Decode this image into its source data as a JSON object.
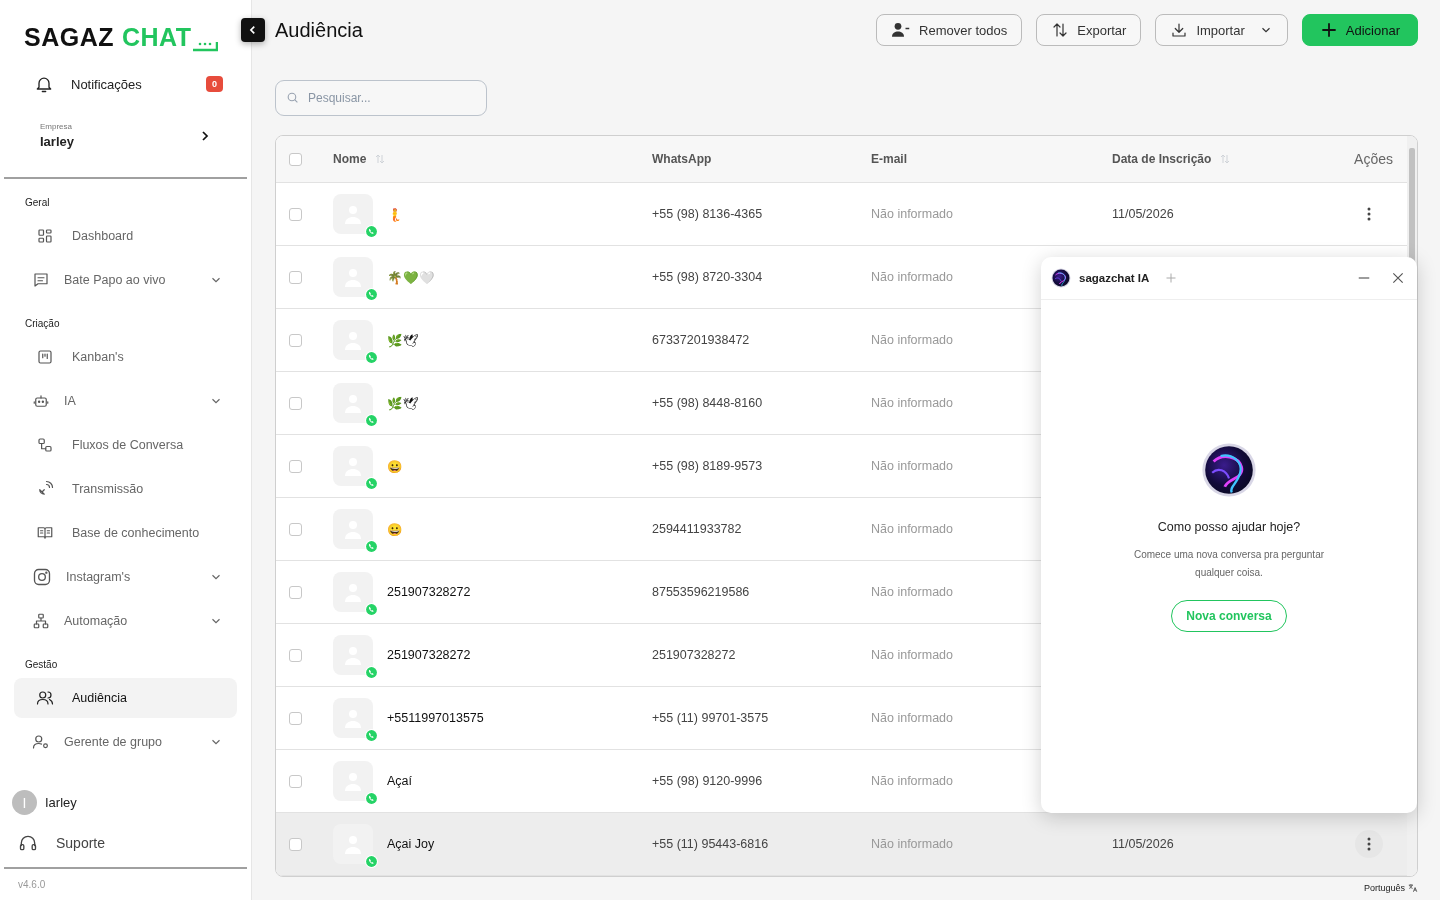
{
  "sidebar": {
    "logo": {
      "dark": "SAGAZ",
      "accent": "CHAT"
    },
    "notifications": {
      "label": "Notificações",
      "count": "0"
    },
    "company": {
      "caption": "Empresa",
      "name": "Iarley"
    },
    "sections": [
      {
        "title": "Geral",
        "items": [
          {
            "label": "Dashboard",
            "expandable": false,
            "selected": false
          },
          {
            "label": "Bate Papo ao vivo",
            "expandable": true,
            "selected": false
          }
        ]
      },
      {
        "title": "Criação",
        "items": [
          {
            "label": "Kanban's",
            "expandable": false,
            "selected": false
          },
          {
            "label": "IA",
            "expandable": true,
            "selected": false
          },
          {
            "label": "Fluxos de Conversa",
            "expandable": false,
            "selected": false
          },
          {
            "label": "Transmissão",
            "expandable": false,
            "selected": false
          },
          {
            "label": "Base de conhecimento",
            "expandable": false,
            "selected": false
          },
          {
            "label": "Instagram's",
            "expandable": true,
            "selected": false
          },
          {
            "label": "Automação",
            "expandable": true,
            "selected": false
          }
        ]
      },
      {
        "title": "Gestão",
        "items": [
          {
            "label": "Audiência",
            "expandable": false,
            "selected": true
          },
          {
            "label": "Gerente de grupo",
            "expandable": true,
            "selected": false
          }
        ]
      }
    ],
    "user": {
      "initial": "I",
      "name": "Iarley"
    },
    "support": "Suporte",
    "version": "v4.6.0"
  },
  "page": {
    "title": "Audiência",
    "actions": [
      {
        "label": "Remover todos",
        "kind": "outline"
      },
      {
        "label": "Exportar",
        "kind": "outline"
      },
      {
        "label": "Importar",
        "kind": "dropdown"
      },
      {
        "label": "Adicionar",
        "kind": "primary"
      }
    ],
    "search": {
      "placeholder": "Pesquisar..."
    }
  },
  "table": {
    "all_checked": false,
    "columns": [
      {
        "label": "Nome",
        "sortable": true
      },
      {
        "label": "WhatsApp",
        "sortable": false
      },
      {
        "label": "E-mail",
        "sortable": false
      },
      {
        "label": "Data de Inscrição",
        "sortable": true
      },
      {
        "label": "Ações",
        "sortable": false
      }
    ],
    "rows": [
      {
        "name": "🧜",
        "whatsapp": "+55 (98) 8136-4365",
        "email": "Não informado",
        "date": "11/05/2026",
        "checked": false,
        "highlighted": false
      },
      {
        "name": "🌴💚🤍",
        "whatsapp": "+55 (98) 8720-3304",
        "email": "Não informado",
        "checked": false,
        "highlighted": false
      },
      {
        "name": "🌿🕊",
        "whatsapp": "67337201938472",
        "email": "Não informado",
        "checked": false,
        "highlighted": false
      },
      {
        "name": "🌿🕊",
        "whatsapp": "+55 (98) 8448-8160",
        "email": "Não informado",
        "checked": false,
        "highlighted": false
      },
      {
        "name": "😀",
        "whatsapp": "+55 (98) 8189-9573",
        "email": "Não informado",
        "checked": false,
        "highlighted": false
      },
      {
        "name": "😀",
        "whatsapp": "2594411933782",
        "email": "Não informado",
        "checked": false,
        "highlighted": false
      },
      {
        "name": "251907328272",
        "whatsapp": "87553596219586",
        "email": "Não informado",
        "checked": false,
        "highlighted": false
      },
      {
        "name": "251907328272",
        "whatsapp": "251907328272",
        "email": "Não informado",
        "checked": false,
        "highlighted": false
      },
      {
        "name": "+5511997013575",
        "whatsapp": "+55 (11) 99701-3575",
        "email": "Não informado",
        "checked": false,
        "highlighted": false
      },
      {
        "name": "Açaí",
        "whatsapp": "+55 (98) 9120-9996",
        "email": "Não informado",
        "checked": false,
        "highlighted": false
      },
      {
        "name": "Açai Joy",
        "whatsapp": "+55 (11) 95443-6816",
        "email": "Não informado",
        "date": "11/05/2026",
        "checked": false,
        "highlighted": true
      }
    ]
  },
  "assistant": {
    "title": "sagazchat IA",
    "heading": "Como posso ajudar hoje?",
    "text": "Comece uma nova conversa pra perguntar qualquer coisa.",
    "button": "Nova conversa"
  },
  "language": "Português"
}
